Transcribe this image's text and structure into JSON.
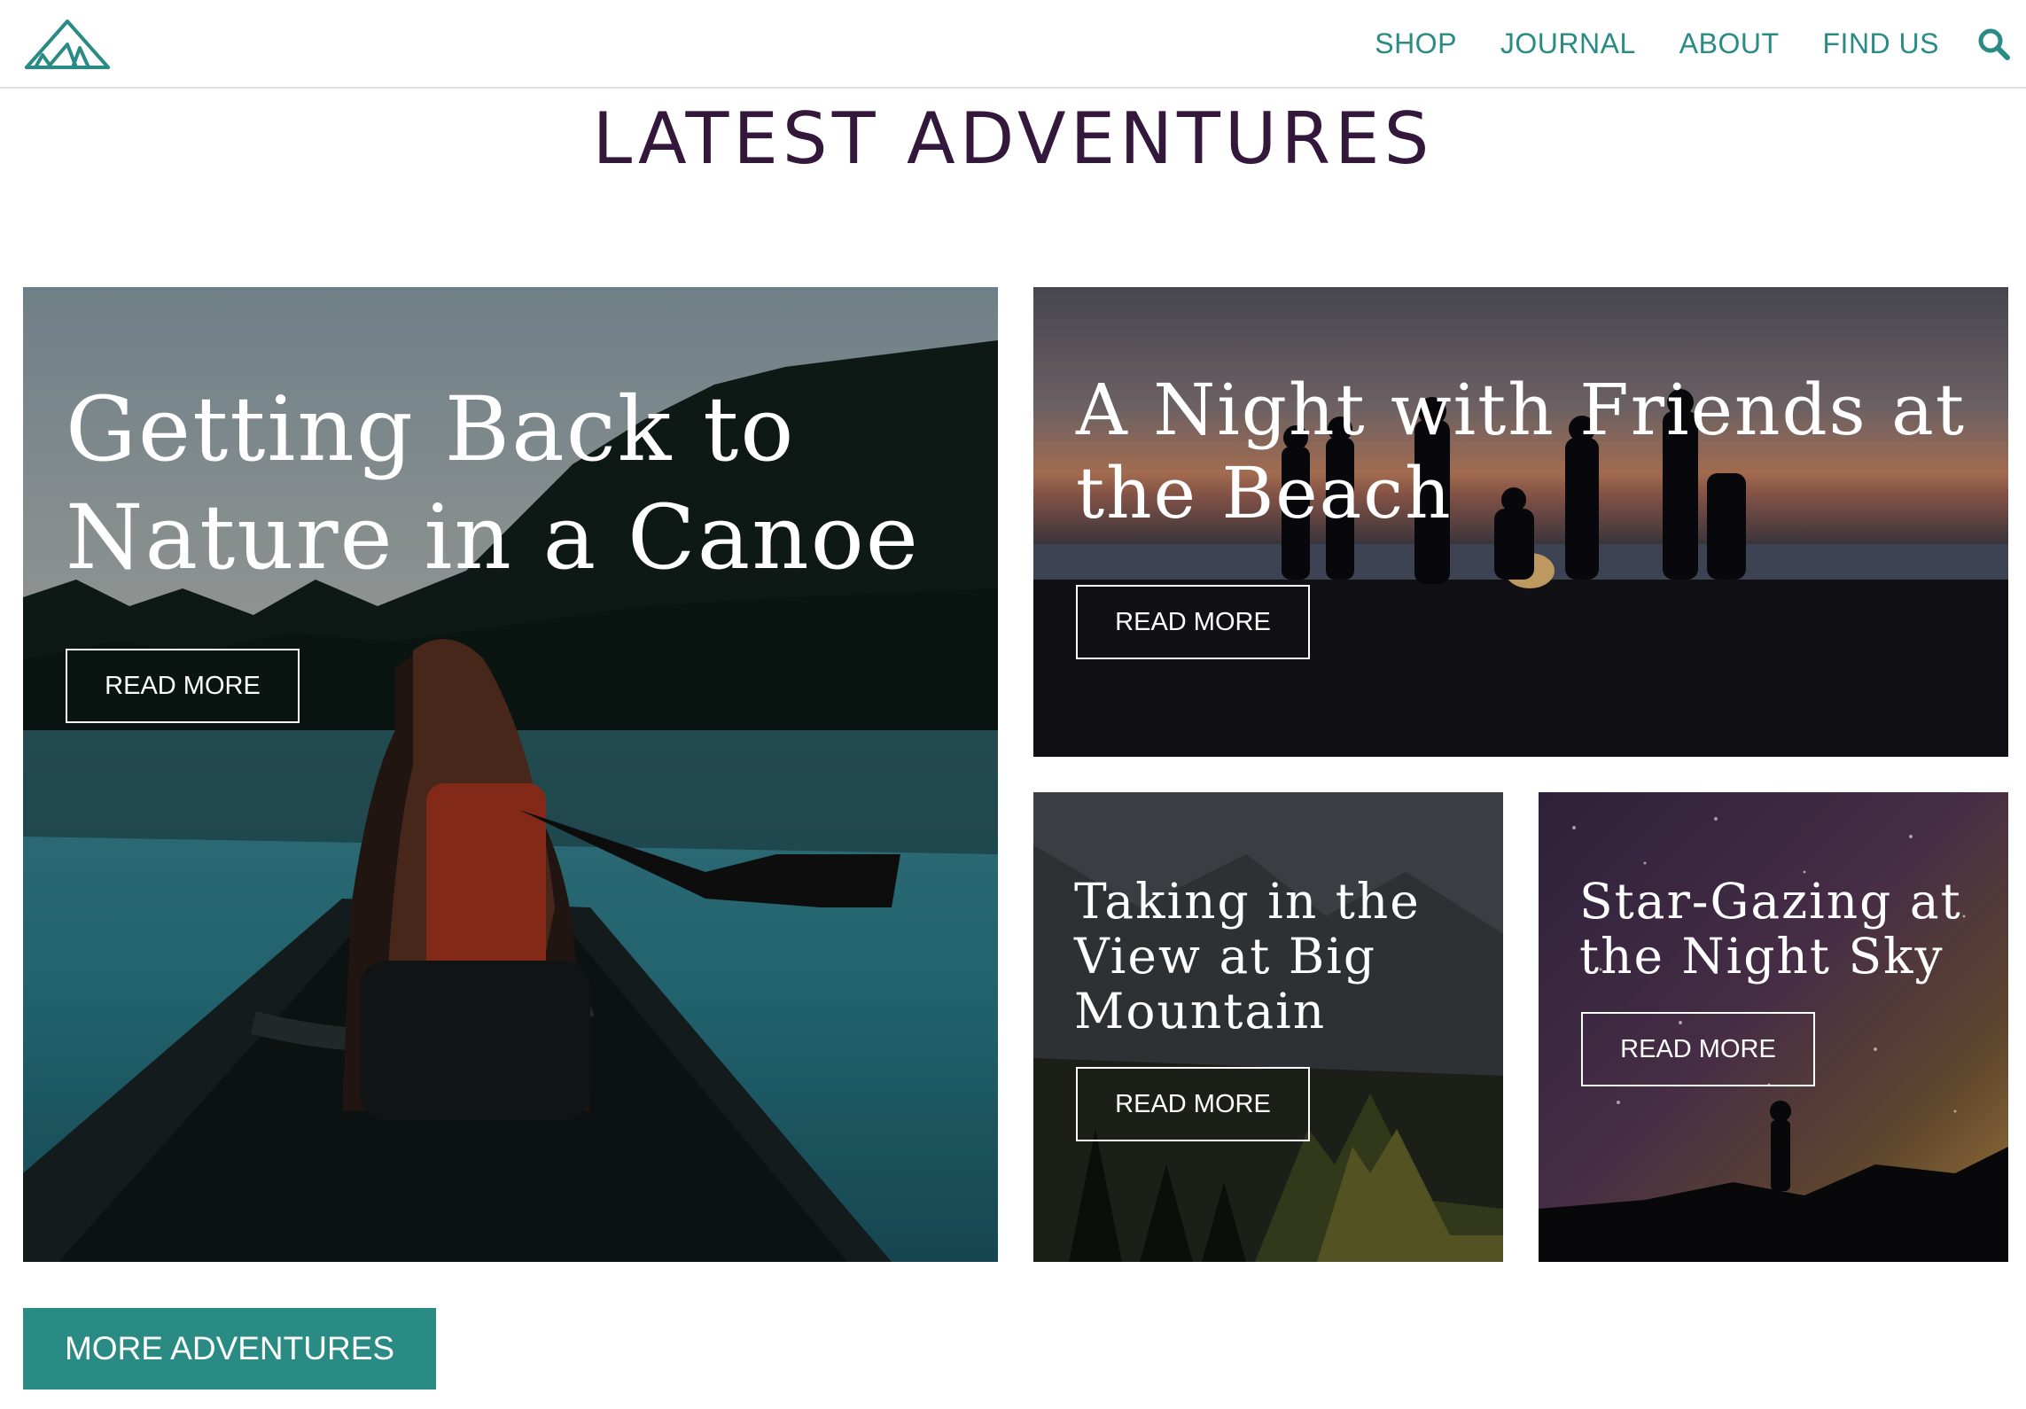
{
  "header": {
    "nav": [
      "SHOP",
      "JOURNAL",
      "ABOUT",
      "FIND US"
    ]
  },
  "page_title": "LATEST ADVENTURES",
  "cards": [
    {
      "title": "Getting Back to Nature in a Canoe",
      "cta": "READ MORE"
    },
    {
      "title": "A Night with Friends at the Beach",
      "cta": "READ MORE"
    },
    {
      "title": "Taking in the View at Big Mountain",
      "cta": "READ MORE"
    },
    {
      "title": "Star-Gazing at the Night Sky",
      "cta": "READ MORE"
    }
  ],
  "more_button": "MORE ADVENTURES",
  "colors": {
    "accent": "#2a8b84",
    "title": "#33183c",
    "divider": "#e2e2e2"
  }
}
